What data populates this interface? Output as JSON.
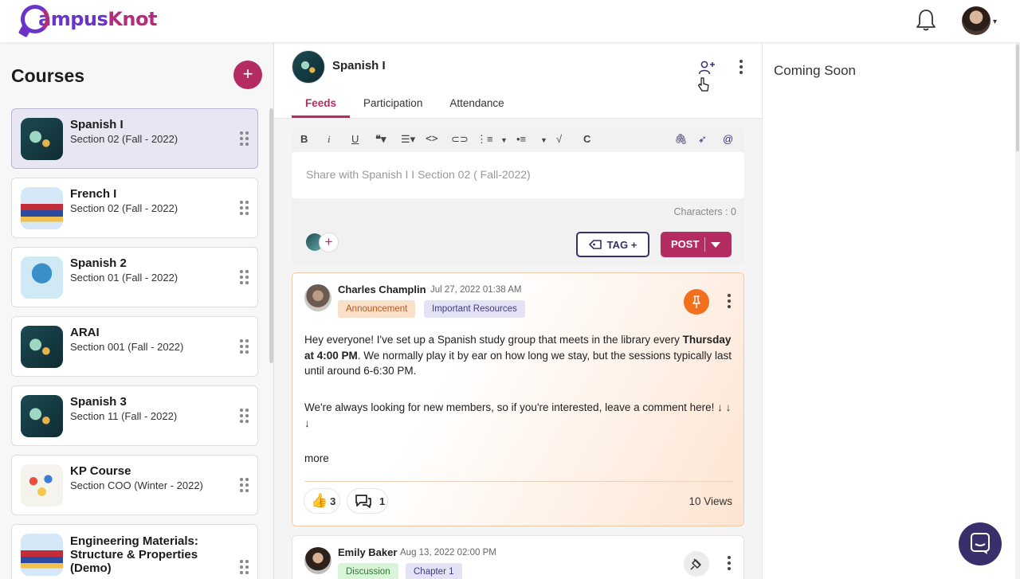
{
  "brand": {
    "part1": "ampus",
    "part2": "Knot",
    "c": "C"
  },
  "sidebar": {
    "title": "Courses",
    "add_symbol": "+",
    "courses": [
      {
        "name": "Spanish I",
        "section": "Section 02 (Fall - 2022)"
      },
      {
        "name": "French I",
        "section": "Section 02 (Fall - 2022)"
      },
      {
        "name": "Spanish 2",
        "section": "Section 01 (Fall - 2022)"
      },
      {
        "name": "ARAI",
        "section": "Section 001 (Fall - 2022)"
      },
      {
        "name": "Spanish 3",
        "section": "Section 11 (Fall - 2022)"
      },
      {
        "name": "KP Course",
        "section": "Section COO (Winter - 2022)"
      },
      {
        "name": "Engineering Materials: Structure & Properties (Demo)",
        "section": ""
      }
    ]
  },
  "course_header": {
    "title": "Spanish I"
  },
  "tabs": [
    "Feeds",
    "Participation",
    "Attendance"
  ],
  "composer": {
    "placeholder": "Share with Spanish I I Section 02 ( Fall-2022)",
    "characters": "Characters : 0",
    "tag_label": "TAG +",
    "post_label": "POST",
    "plus": "+"
  },
  "posts": [
    {
      "author": "Charles Champlin",
      "date": "Jul 27, 2022 01:38 AM",
      "tags": [
        "Announcement",
        "Important Resources"
      ],
      "body_pre": "Hey everyone! I've set up a Spanish study group that meets in the library every ",
      "body_bold": "Thursday at 4:00 PM",
      "body_post": ". We normally play it by ear on how long we stay, but the sessions typically last until around 6-6:30 PM.",
      "body_2": "We're always looking for new members, so if you're interested, leave a comment here! ↓ ↓ ↓",
      "more": "more",
      "likes": "3",
      "comments": "1",
      "views": "10 Views"
    },
    {
      "author": "Emily Baker",
      "date": "Aug 13, 2022 02:00 PM",
      "tags": [
        "Discussion",
        "Chapter 1"
      ]
    }
  ],
  "right_panel": {
    "title": "Coming Soon"
  },
  "colors": {
    "brand_purple": "#6b34c9",
    "brand_magenta": "#b52c62",
    "navy": "#37306b",
    "pin_orange": "#f26f1c"
  }
}
